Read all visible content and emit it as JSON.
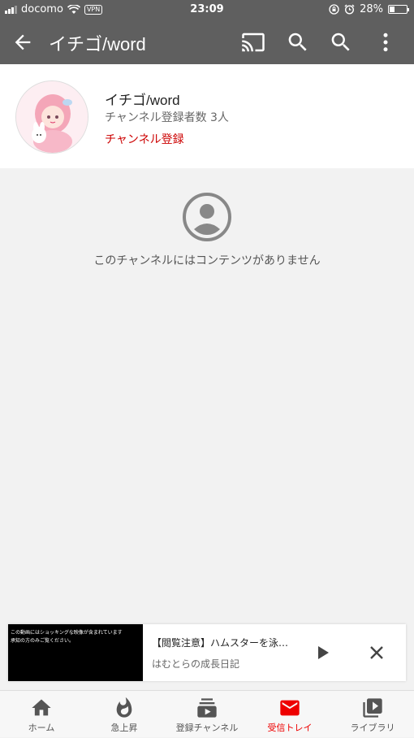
{
  "status_bar": {
    "carrier": "docomo",
    "vpn": "VPN",
    "time": "23:09",
    "battery": "28%",
    "battery_level": 0.28
  },
  "app_bar": {
    "title": "イチゴ/word"
  },
  "channel": {
    "name": "イチゴ/word",
    "subscribers": "チャンネル登録者数 3人",
    "subscribe_label": "チャンネル登録"
  },
  "empty_state": {
    "message": "このチャンネルにはコンテンツがありません"
  },
  "mini_player": {
    "thumbnail_text": "この動画にはショッキングな映像が含まれています\n承知の方のみご覧ください。",
    "title": "【閲覧注意】ハムスターを泳…",
    "channel": "はむとらの成長日記"
  },
  "bottom_nav": {
    "items": [
      {
        "label": "ホーム",
        "icon": "home-icon"
      },
      {
        "label": "急上昇",
        "icon": "trending-icon"
      },
      {
        "label": "登録チャンネル",
        "icon": "subscriptions-icon"
      },
      {
        "label": "受信トレイ",
        "icon": "inbox-icon"
      },
      {
        "label": "ライブラリ",
        "icon": "library-icon"
      }
    ],
    "active_index": 3
  },
  "colors": {
    "appbar": "#5f5f5f",
    "accent_red": "#cc0000",
    "background": "#f2f2f2"
  }
}
